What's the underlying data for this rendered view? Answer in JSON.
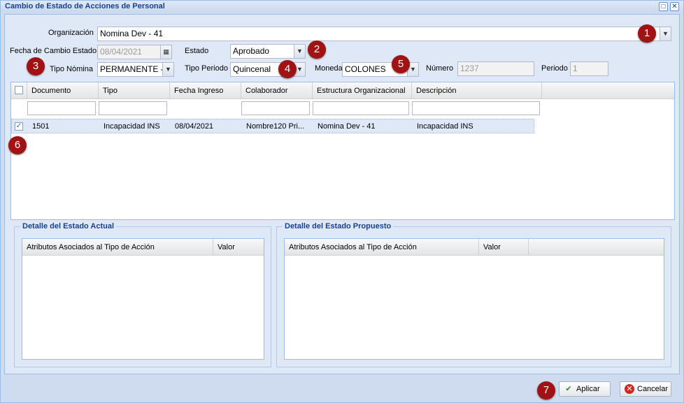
{
  "window": {
    "title": "Cambio de Estado de Acciones de Personal"
  },
  "form": {
    "organizacion": {
      "label": "Organización",
      "value": "Nomina Dev - 41"
    },
    "fecha_cambio": {
      "label": "Fecha de Cambio Estado",
      "value": "08/04/2021"
    },
    "estado": {
      "label": "Estado",
      "value": "Aprobado"
    },
    "tipo_nomina": {
      "label": "Tipo Nómina",
      "value": "PERMANENTE -"
    },
    "tipo_periodo": {
      "label": "Tipo Periodo",
      "value": "Quincenal"
    },
    "moneda": {
      "label": "Moneda",
      "value": "COLONES"
    },
    "numero": {
      "label": "Número",
      "value": "1237"
    },
    "periodo": {
      "label": "Periodo",
      "value": "1"
    }
  },
  "grid": {
    "columns": [
      "Documento",
      "Tipo",
      "Fecha Ingreso",
      "Colaborador",
      "Estructura Organizacional",
      "Descripción"
    ],
    "rows": [
      {
        "checked": true,
        "cells": [
          "1501",
          "Incapacidad INS",
          "08/04/2021",
          "Nombre120 Pri...",
          "Nomina Dev - 41",
          "Incapacidad INS"
        ]
      }
    ]
  },
  "detalle_actual": {
    "title": "Detalle del Estado Actual",
    "columns": [
      "Atributos Asociados al Tipo de Acción",
      "Valor"
    ]
  },
  "detalle_propuesto": {
    "title": "Detalle del Estado Propuesto",
    "columns": [
      "Atributos Asociados al Tipo de Acción",
      "Valor"
    ]
  },
  "buttons": {
    "aplicar": "Aplicar",
    "cancelar": "Cancelar"
  },
  "badges": [
    "1",
    "2",
    "3",
    "4",
    "5",
    "6",
    "7"
  ],
  "icons": {
    "dropdown": "chevron-down-icon",
    "calendar": "calendar-icon",
    "aplicar": "checkmark-icon",
    "cancelar": "cancel-icon"
  },
  "colors": {
    "title": "#15428b",
    "badge": "#a01214",
    "selected_row": "#dfe8f6"
  }
}
